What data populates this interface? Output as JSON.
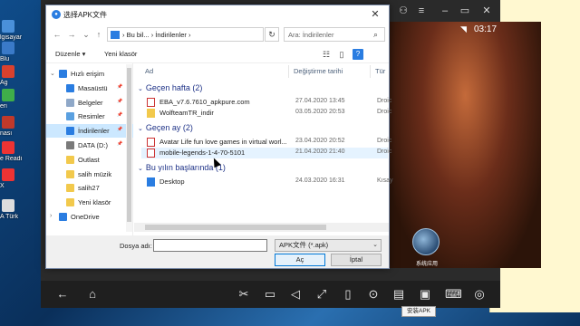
{
  "desktop": {
    "icons": [
      {
        "label": "lgisayar",
        "color": "#4a90d9"
      },
      {
        "label": "Blu",
        "color": "#3a7ac8"
      },
      {
        "label": "Ag",
        "color": "#d9412e"
      },
      {
        "label": "eri",
        "color": "#3fae4a"
      },
      {
        "label": "nası",
        "color": "#c0392b"
      },
      {
        "label": "e Readi",
        "color": "#e33"
      },
      {
        "label": "X",
        "color": "#e33"
      },
      {
        "label": "A Türk",
        "color": "#ddd"
      }
    ]
  },
  "emulator": {
    "time": "03:17",
    "app_label": "系统应用",
    "tooltip": "安装APK"
  },
  "dialog": {
    "title": "选择APK文件",
    "close": "✕",
    "address": {
      "crumb1": "Bu bil...",
      "crumb2": "İndirilenler",
      "sep": "›"
    },
    "search_placeholder": "Ara: İndirilenler",
    "toolbar": {
      "organize": "Düzenle ▾",
      "new_folder": "Yeni klasör"
    },
    "sidebar": [
      {
        "label": "Hızlı erişim",
        "icon": "star-icon",
        "color": "#2a7de1",
        "level": 0,
        "pinned": false,
        "selected": false,
        "chevron": "⌄"
      },
      {
        "label": "Masaüstü",
        "icon": "desktop-icon",
        "color": "#2a7de1",
        "level": 1,
        "pinned": true,
        "selected": false
      },
      {
        "label": "Belgeler",
        "icon": "documents-icon",
        "color": "#8fa8c8",
        "level": 1,
        "pinned": true,
        "selected": false
      },
      {
        "label": "Resimler",
        "icon": "pictures-icon",
        "color": "#5aa0e0",
        "level": 1,
        "pinned": true,
        "selected": false
      },
      {
        "label": "İndirilenler",
        "icon": "downloads-icon",
        "color": "#2a7de1",
        "level": 1,
        "pinned": true,
        "selected": true
      },
      {
        "label": "DATA (D:)",
        "icon": "drive-icon",
        "color": "#7a7a7a",
        "level": 1,
        "pinned": true,
        "selected": false
      },
      {
        "label": "Outlast",
        "icon": "folder-icon",
        "color": "#f2c94c",
        "level": 1,
        "pinned": false,
        "selected": false
      },
      {
        "label": "salih müzik",
        "icon": "folder-icon",
        "color": "#f2c94c",
        "level": 1,
        "pinned": false,
        "selected": false
      },
      {
        "label": "salih27",
        "icon": "folder-icon",
        "color": "#f2c94c",
        "level": 1,
        "pinned": false,
        "selected": false
      },
      {
        "label": "Yeni klasör",
        "icon": "folder-icon",
        "color": "#f2c94c",
        "level": 1,
        "pinned": false,
        "selected": false
      },
      {
        "label": "OneDrive",
        "icon": "cloud-icon",
        "color": "#2a7de1",
        "level": 0,
        "pinned": false,
        "selected": false,
        "chevron": "›"
      }
    ],
    "columns": {
      "name": "Ad",
      "date": "Değiştirme tarihi",
      "type": "Tür"
    },
    "groups": [
      {
        "label": "Geçen hafta (2)",
        "rows": [
          {
            "name": "EBA_v7.6.7610_apkpure.com",
            "date": "27.04.2020 13:45",
            "type": "Droic",
            "icon": "apk-icon",
            "highlight": false
          },
          {
            "name": "WolfteamTR_indir",
            "date": "03.05.2020 20:53",
            "type": "Droic",
            "icon": "folder-icon",
            "highlight": false
          }
        ]
      },
      {
        "label": "Geçen ay (2)",
        "rows": [
          {
            "name": "Avatar Life fun love games in virtual worl...",
            "date": "23.04.2020 20:52",
            "type": "Droic",
            "icon": "apk-icon",
            "highlight": false
          },
          {
            "name": "mobile-legends-1-4-70-5101",
            "date": "21.04.2020 21:40",
            "type": "Droic",
            "icon": "apk-icon",
            "highlight": true
          }
        ]
      },
      {
        "label": "Bu yılın başlarında (1)",
        "rows": [
          {
            "name": "Desktop",
            "date": "24.03.2020 16:31",
            "type": "Kısay",
            "icon": "shortcut-icon",
            "highlight": false
          }
        ]
      }
    ],
    "bottom": {
      "filename_label": "Dosya adı:",
      "filename_value": "",
      "filetype": "APK文件 (*.apk)",
      "open": "Aç",
      "cancel": "İptal"
    }
  }
}
